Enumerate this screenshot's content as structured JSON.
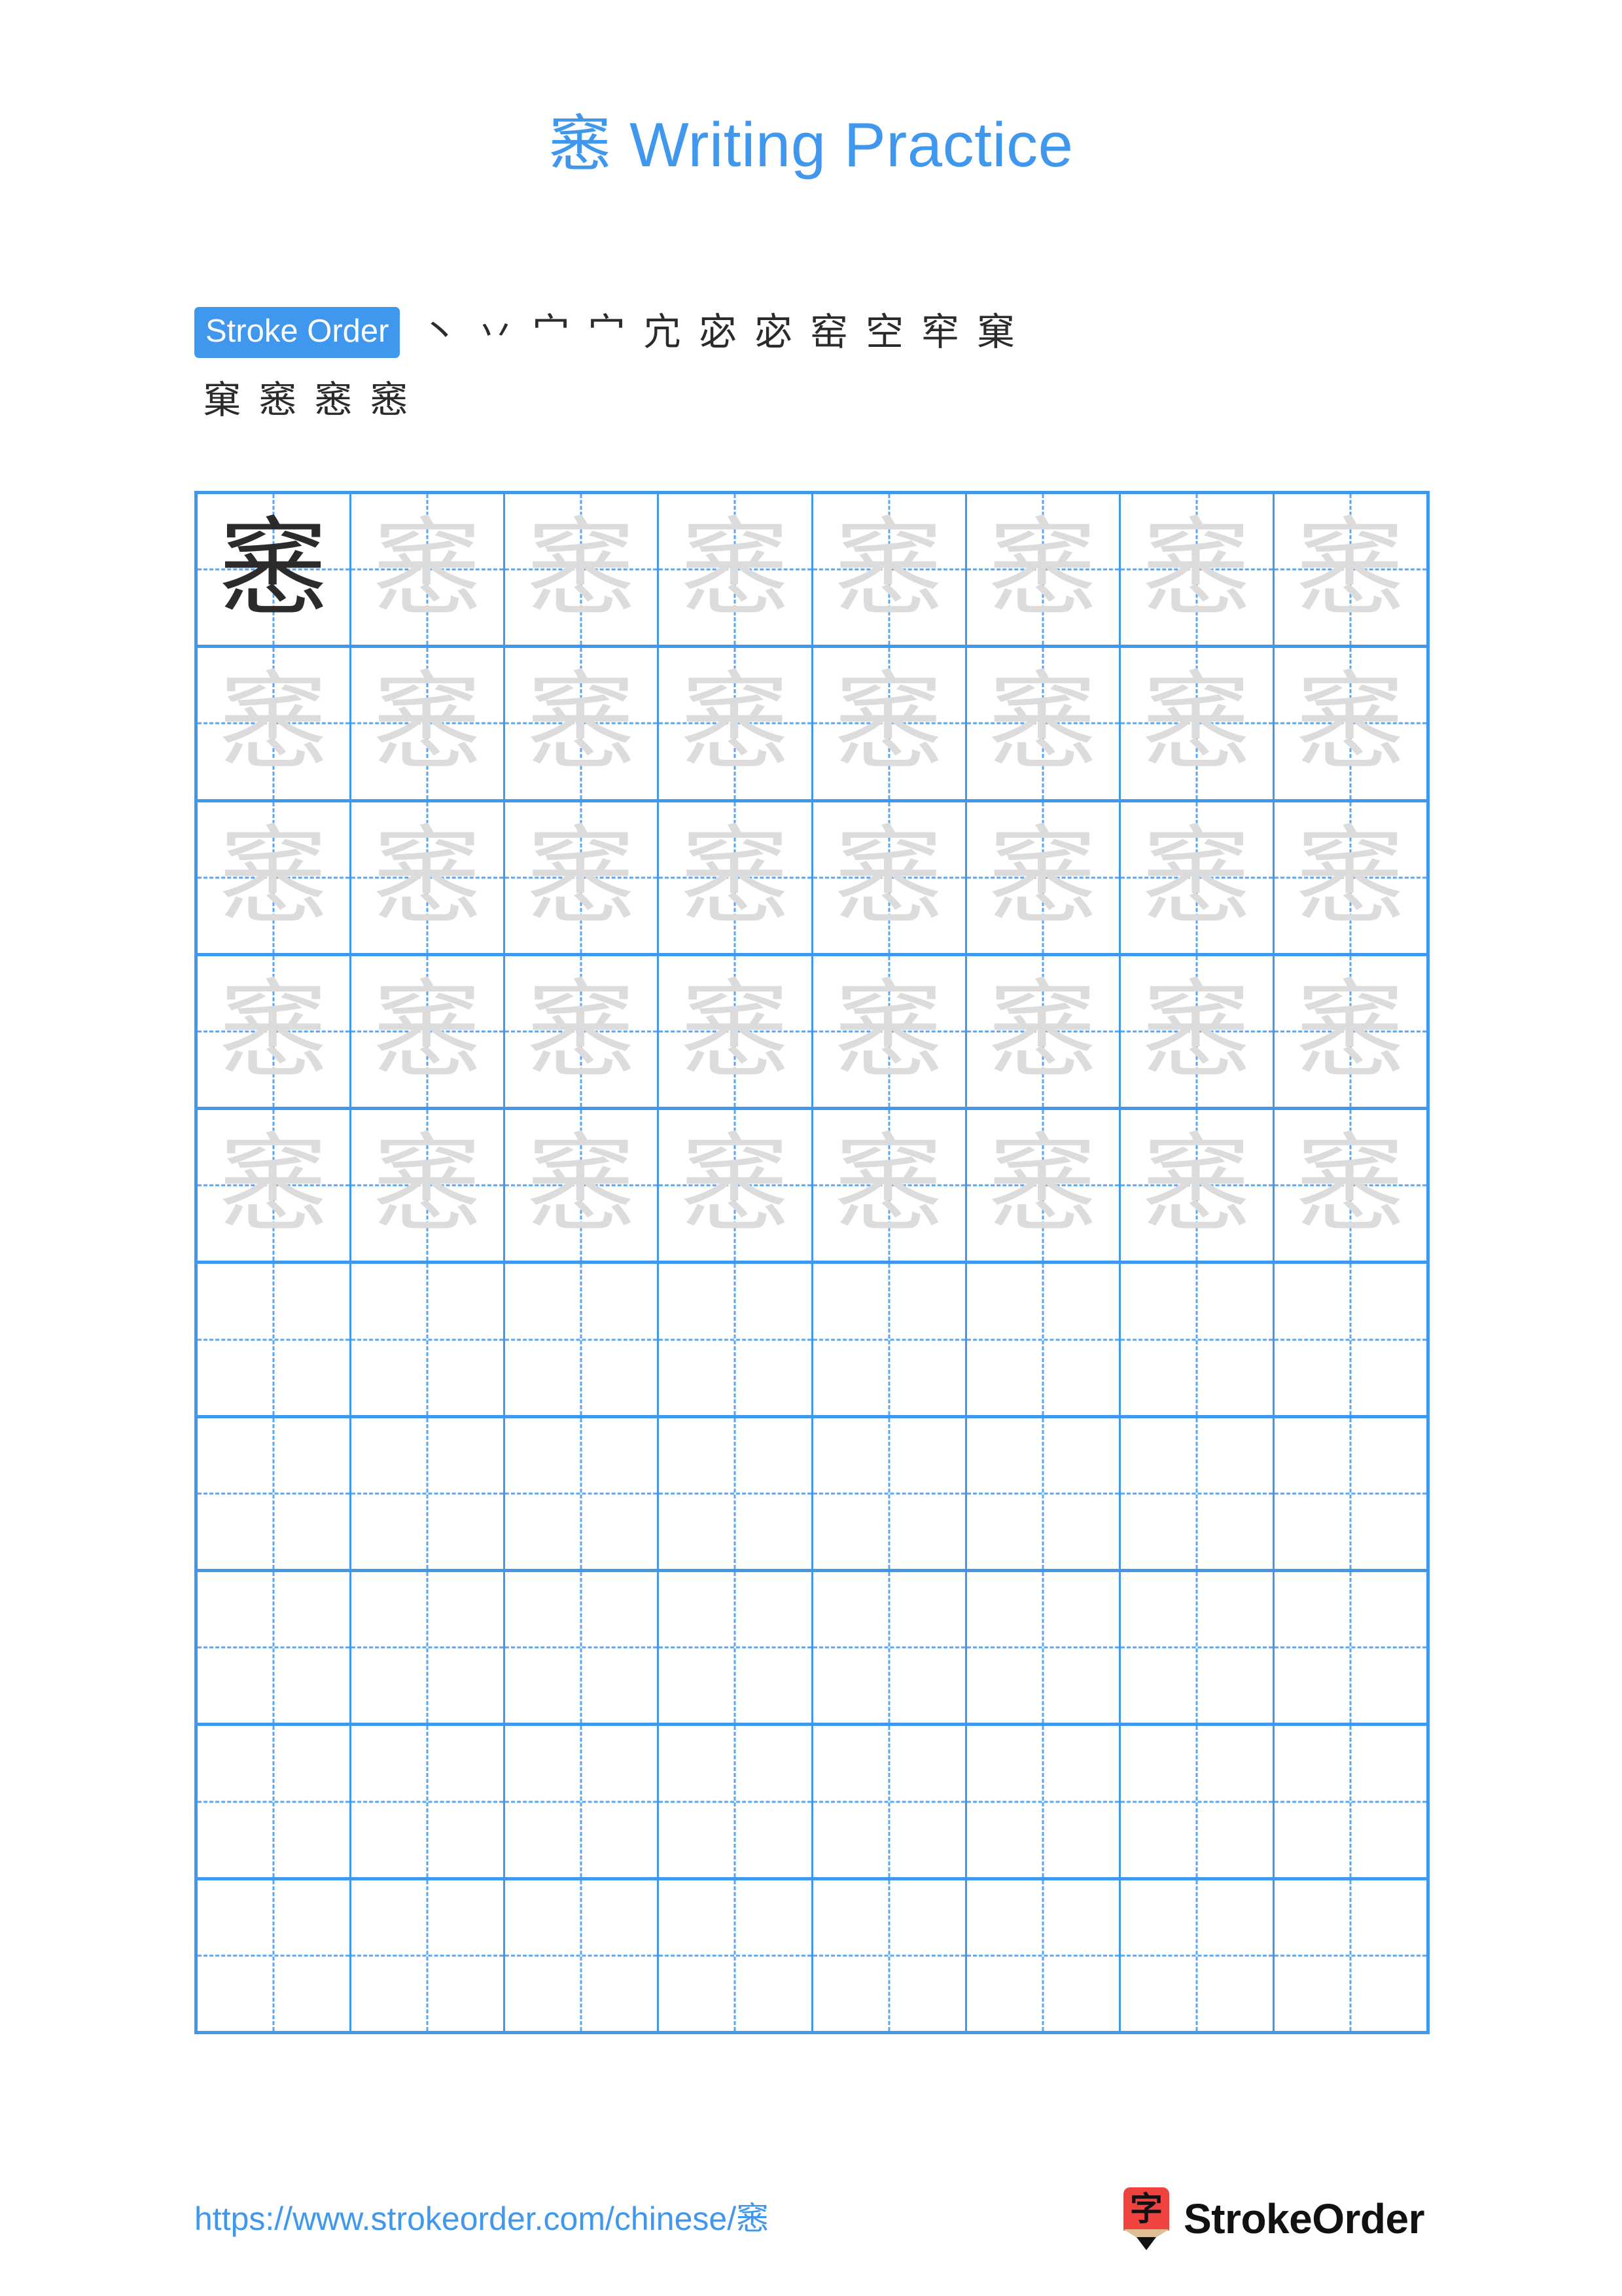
{
  "character": "窸",
  "header": {
    "title_character": "窸",
    "title_text": "Writing Practice"
  },
  "stroke_order": {
    "badge_label": "Stroke Order",
    "total_strokes": 15,
    "new_stroke_color": "#ee1b1b",
    "drawn_stroke_color": "#2b2b2b",
    "row1": [
      "丶",
      "丷",
      "宀",
      "宀",
      "宂",
      "宓",
      "宓",
      "窑",
      "空",
      "窂",
      "窂",
      "窠"
    ],
    "row2": [
      "窠",
      "窸",
      "窸",
      "窸"
    ],
    "sequence_row1": [
      "丶",
      "丷",
      "宀",
      "宀",
      "宂",
      "宓",
      "宓",
      "窑",
      "空",
      "窂",
      "窠"
    ],
    "sequence_row2": [
      "窠",
      "窸",
      "窸",
      "窸"
    ]
  },
  "grid": {
    "columns": 8,
    "rows": 10,
    "filled_rows": 5,
    "empty_rows": 5,
    "model_cell_index": 0,
    "model_color": "#2b2b2b",
    "trace_color": "#dcdcdc",
    "line_color": "#3f97ee",
    "cell_character": "窸"
  },
  "footer": {
    "url": "https://www.strokeorder.com/chinese/",
    "url_character": "窸",
    "brand_name": "StrokeOrder",
    "logo_character": "字",
    "logo_color": "#f0433f"
  },
  "colors": {
    "accent_blue": "#3f97ee",
    "grid_blue": "#5aa7f0",
    "ink_black": "#2b2b2b",
    "trace_gray": "#dcdcdc",
    "logo_red": "#f0433f",
    "logo_wood": "#e0be93"
  }
}
